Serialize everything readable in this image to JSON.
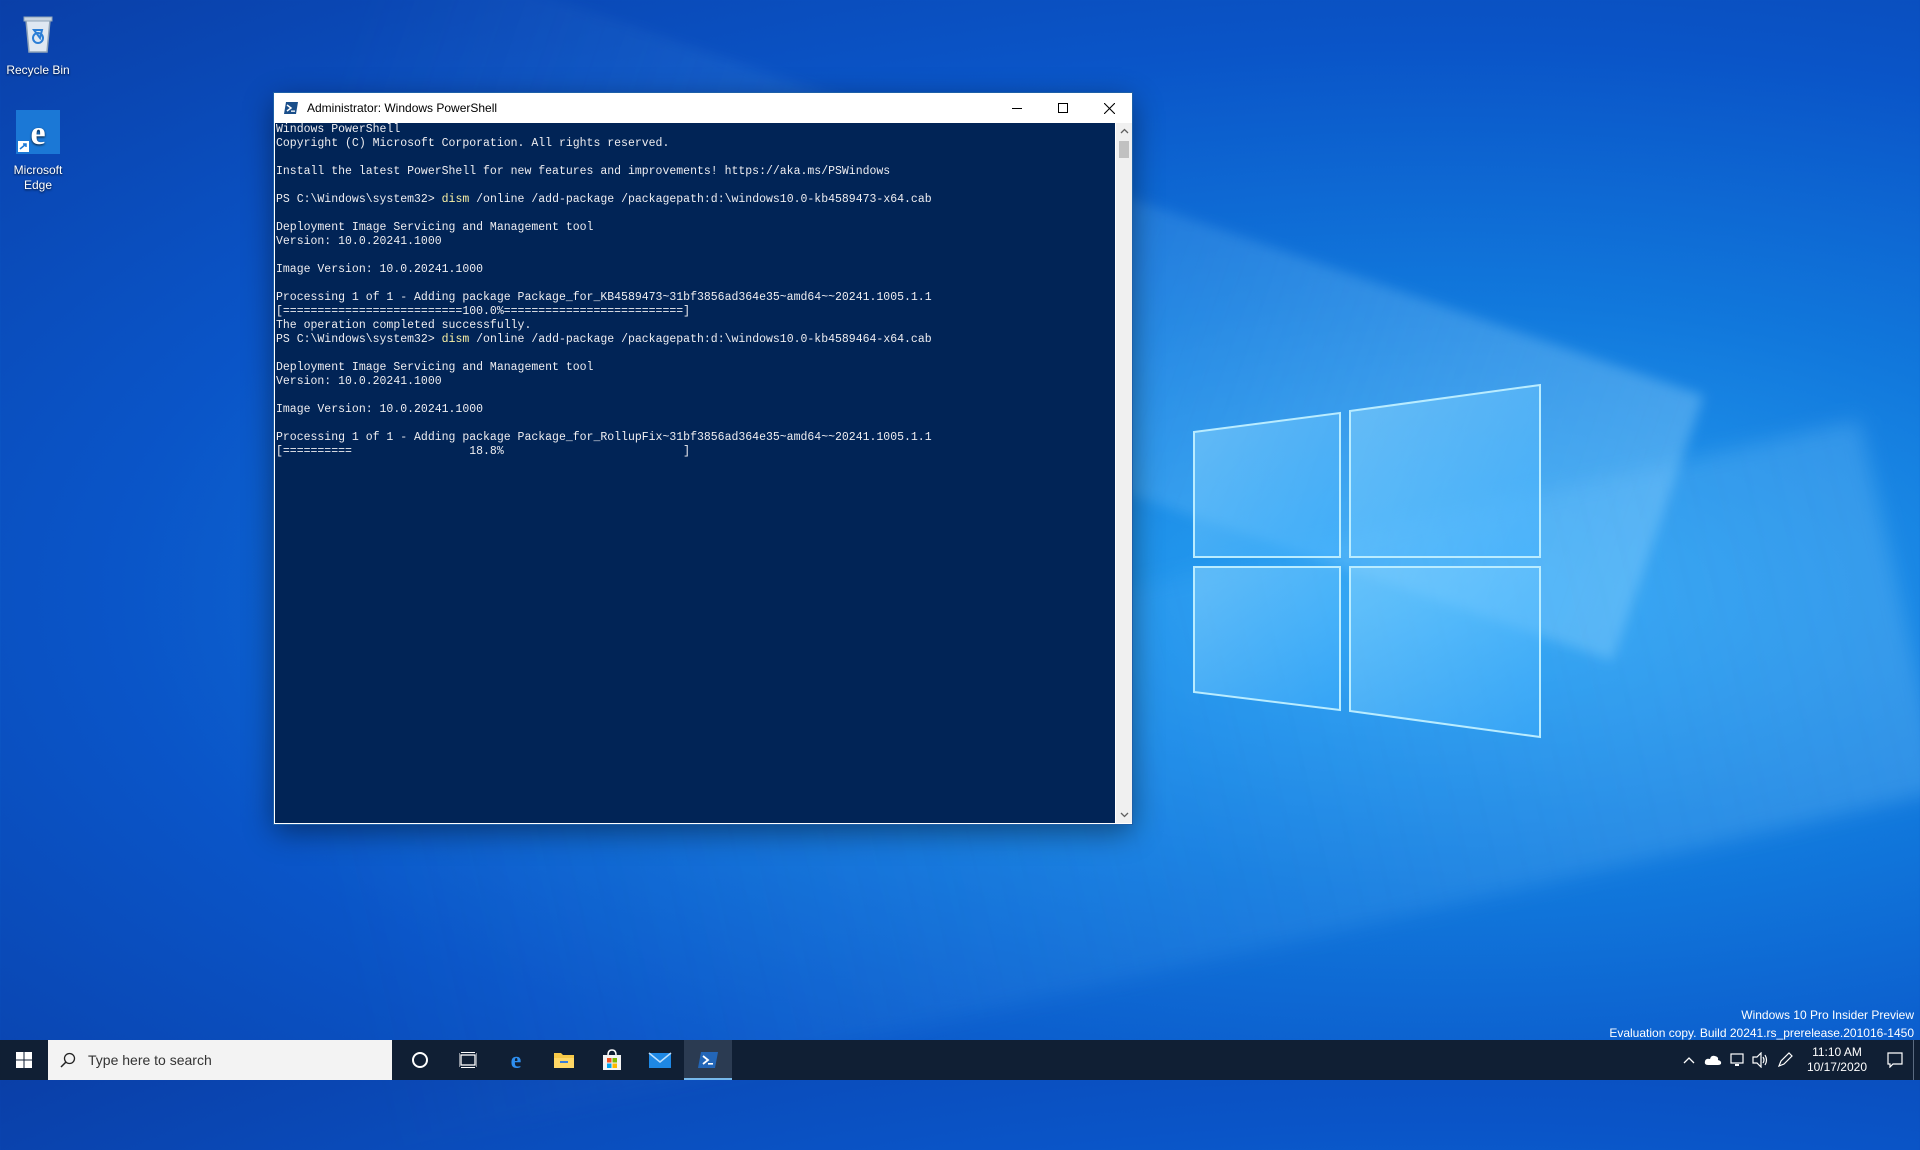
{
  "desktop": {
    "icons": [
      {
        "label": "Recycle Bin",
        "icon": "recycle-bin-icon"
      },
      {
        "label": "Microsoft\nEdge",
        "icon": "edge-icon"
      }
    ],
    "watermark": {
      "line1": "Windows 10 Pro Insider Preview",
      "line2": "Evaluation copy. Build 20241.rs_prerelease.201016-1450"
    }
  },
  "window": {
    "title": "Administrator: Windows PowerShell",
    "icon": "powershell-icon",
    "controls": {
      "minimize": "minimize-icon",
      "maximize": "maximize-icon",
      "close": "close-icon"
    },
    "console": {
      "background": "#012456",
      "foreground": "#eeedf0",
      "command_color": "#f9f1a5",
      "lines": [
        {
          "text": "Windows PowerShell"
        },
        {
          "text": "Copyright (C) Microsoft Corporation. All rights reserved."
        },
        {
          "text": ""
        },
        {
          "text": "Install the latest PowerShell for new features and improvements! https://aka.ms/PSWindows"
        },
        {
          "text": ""
        },
        {
          "prompt": "PS C:\\Windows\\system32> ",
          "cmd": "dism",
          "args": " /online /add-package /packagepath:d:\\windows10.0-kb4589473-x64.cab"
        },
        {
          "text": ""
        },
        {
          "text": "Deployment Image Servicing and Management tool"
        },
        {
          "text": "Version: 10.0.20241.1000"
        },
        {
          "text": ""
        },
        {
          "text": "Image Version: 10.0.20241.1000"
        },
        {
          "text": ""
        },
        {
          "text": "Processing 1 of 1 - Adding package Package_for_KB4589473~31bf3856ad364e35~amd64~~20241.1005.1.1"
        },
        {
          "text": "[==========================100.0%==========================]"
        },
        {
          "text": "The operation completed successfully."
        },
        {
          "prompt": "PS C:\\Windows\\system32> ",
          "cmd": "dism",
          "args": " /online /add-package /packagepath:d:\\windows10.0-kb4589464-x64.cab"
        },
        {
          "text": ""
        },
        {
          "text": "Deployment Image Servicing and Management tool"
        },
        {
          "text": "Version: 10.0.20241.1000"
        },
        {
          "text": ""
        },
        {
          "text": "Image Version: 10.0.20241.1000"
        },
        {
          "text": ""
        },
        {
          "text": "Processing 1 of 1 - Adding package Package_for_RollupFix~31bf3856ad364e35~amd64~~20241.1005.1.1"
        },
        {
          "text": "[==========                 18.8%                          ]"
        }
      ]
    }
  },
  "taskbar": {
    "search_placeholder": "Type here to search",
    "apps": [
      {
        "name": "cortana",
        "icon": "cortana-circle-icon"
      },
      {
        "name": "task-view",
        "icon": "task-view-icon"
      },
      {
        "name": "edge",
        "icon": "edge-icon"
      },
      {
        "name": "file-explorer",
        "icon": "folder-icon"
      },
      {
        "name": "store",
        "icon": "store-bag-icon"
      },
      {
        "name": "mail",
        "icon": "mail-icon"
      },
      {
        "name": "powershell",
        "icon": "powershell-icon",
        "active": true
      }
    ],
    "tray": {
      "time": "11:10 AM",
      "date": "10/17/2020"
    }
  }
}
